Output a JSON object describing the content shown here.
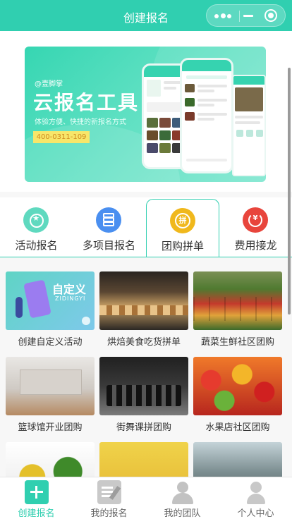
{
  "header": {
    "title": "创建报名"
  },
  "banner": {
    "brand": "@壹脚掌",
    "title": "云报名工具",
    "subtitle": "体验方便、快捷的新报名方式",
    "phone": "400-0311-109"
  },
  "tabs": [
    {
      "label": "活动报名",
      "icon": "activity-icon",
      "active": false
    },
    {
      "label": "多项目报名",
      "icon": "layers-icon",
      "active": false
    },
    {
      "label": "团购拼单",
      "icon": "group-buy-icon",
      "active": true,
      "glyph": "拼"
    },
    {
      "label": "费用接龙",
      "icon": "fee-relay-icon",
      "active": false,
      "glyph": "¥"
    }
  ],
  "templates": [
    {
      "caption": "创建自定义活动",
      "thumb_title": "自定义",
      "thumb_sub": "ZIDINGYI"
    },
    {
      "caption": "烘焙美食吃货拼单"
    },
    {
      "caption": "蔬菜生鲜社区团购"
    },
    {
      "caption": "篮球馆开业团购"
    },
    {
      "caption": "街舞课拼团购"
    },
    {
      "caption": "水果店社区团购"
    }
  ],
  "tabbar": [
    {
      "label": "创建报名",
      "icon": "plus-icon",
      "active": true
    },
    {
      "label": "我的报名",
      "icon": "edit-doc-icon",
      "active": false
    },
    {
      "label": "我的团队",
      "icon": "team-icon",
      "active": false
    },
    {
      "label": "个人中心",
      "icon": "user-icon",
      "active": false
    }
  ],
  "colors": {
    "accent": "#30cfb0",
    "text": "#333333",
    "muted": "#666666"
  }
}
